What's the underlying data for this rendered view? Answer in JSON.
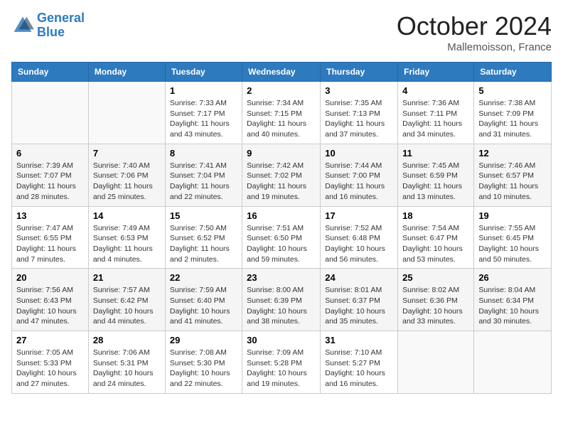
{
  "header": {
    "logo_line1": "General",
    "logo_line2": "Blue",
    "month_title": "October 2024",
    "location": "Mallemoisson, France"
  },
  "weekdays": [
    "Sunday",
    "Monday",
    "Tuesday",
    "Wednesday",
    "Thursday",
    "Friday",
    "Saturday"
  ],
  "weeks": [
    [
      {
        "day": "",
        "sunrise": "",
        "sunset": "",
        "daylight": ""
      },
      {
        "day": "",
        "sunrise": "",
        "sunset": "",
        "daylight": ""
      },
      {
        "day": "1",
        "sunrise": "Sunrise: 7:33 AM",
        "sunset": "Sunset: 7:17 PM",
        "daylight": "Daylight: 11 hours and 43 minutes."
      },
      {
        "day": "2",
        "sunrise": "Sunrise: 7:34 AM",
        "sunset": "Sunset: 7:15 PM",
        "daylight": "Daylight: 11 hours and 40 minutes."
      },
      {
        "day": "3",
        "sunrise": "Sunrise: 7:35 AM",
        "sunset": "Sunset: 7:13 PM",
        "daylight": "Daylight: 11 hours and 37 minutes."
      },
      {
        "day": "4",
        "sunrise": "Sunrise: 7:36 AM",
        "sunset": "Sunset: 7:11 PM",
        "daylight": "Daylight: 11 hours and 34 minutes."
      },
      {
        "day": "5",
        "sunrise": "Sunrise: 7:38 AM",
        "sunset": "Sunset: 7:09 PM",
        "daylight": "Daylight: 11 hours and 31 minutes."
      }
    ],
    [
      {
        "day": "6",
        "sunrise": "Sunrise: 7:39 AM",
        "sunset": "Sunset: 7:07 PM",
        "daylight": "Daylight: 11 hours and 28 minutes."
      },
      {
        "day": "7",
        "sunrise": "Sunrise: 7:40 AM",
        "sunset": "Sunset: 7:06 PM",
        "daylight": "Daylight: 11 hours and 25 minutes."
      },
      {
        "day": "8",
        "sunrise": "Sunrise: 7:41 AM",
        "sunset": "Sunset: 7:04 PM",
        "daylight": "Daylight: 11 hours and 22 minutes."
      },
      {
        "day": "9",
        "sunrise": "Sunrise: 7:42 AM",
        "sunset": "Sunset: 7:02 PM",
        "daylight": "Daylight: 11 hours and 19 minutes."
      },
      {
        "day": "10",
        "sunrise": "Sunrise: 7:44 AM",
        "sunset": "Sunset: 7:00 PM",
        "daylight": "Daylight: 11 hours and 16 minutes."
      },
      {
        "day": "11",
        "sunrise": "Sunrise: 7:45 AM",
        "sunset": "Sunset: 6:59 PM",
        "daylight": "Daylight: 11 hours and 13 minutes."
      },
      {
        "day": "12",
        "sunrise": "Sunrise: 7:46 AM",
        "sunset": "Sunset: 6:57 PM",
        "daylight": "Daylight: 11 hours and 10 minutes."
      }
    ],
    [
      {
        "day": "13",
        "sunrise": "Sunrise: 7:47 AM",
        "sunset": "Sunset: 6:55 PM",
        "daylight": "Daylight: 11 hours and 7 minutes."
      },
      {
        "day": "14",
        "sunrise": "Sunrise: 7:49 AM",
        "sunset": "Sunset: 6:53 PM",
        "daylight": "Daylight: 11 hours and 4 minutes."
      },
      {
        "day": "15",
        "sunrise": "Sunrise: 7:50 AM",
        "sunset": "Sunset: 6:52 PM",
        "daylight": "Daylight: 11 hours and 2 minutes."
      },
      {
        "day": "16",
        "sunrise": "Sunrise: 7:51 AM",
        "sunset": "Sunset: 6:50 PM",
        "daylight": "Daylight: 10 hours and 59 minutes."
      },
      {
        "day": "17",
        "sunrise": "Sunrise: 7:52 AM",
        "sunset": "Sunset: 6:48 PM",
        "daylight": "Daylight: 10 hours and 56 minutes."
      },
      {
        "day": "18",
        "sunrise": "Sunrise: 7:54 AM",
        "sunset": "Sunset: 6:47 PM",
        "daylight": "Daylight: 10 hours and 53 minutes."
      },
      {
        "day": "19",
        "sunrise": "Sunrise: 7:55 AM",
        "sunset": "Sunset: 6:45 PM",
        "daylight": "Daylight: 10 hours and 50 minutes."
      }
    ],
    [
      {
        "day": "20",
        "sunrise": "Sunrise: 7:56 AM",
        "sunset": "Sunset: 6:43 PM",
        "daylight": "Daylight: 10 hours and 47 minutes."
      },
      {
        "day": "21",
        "sunrise": "Sunrise: 7:57 AM",
        "sunset": "Sunset: 6:42 PM",
        "daylight": "Daylight: 10 hours and 44 minutes."
      },
      {
        "day": "22",
        "sunrise": "Sunrise: 7:59 AM",
        "sunset": "Sunset: 6:40 PM",
        "daylight": "Daylight: 10 hours and 41 minutes."
      },
      {
        "day": "23",
        "sunrise": "Sunrise: 8:00 AM",
        "sunset": "Sunset: 6:39 PM",
        "daylight": "Daylight: 10 hours and 38 minutes."
      },
      {
        "day": "24",
        "sunrise": "Sunrise: 8:01 AM",
        "sunset": "Sunset: 6:37 PM",
        "daylight": "Daylight: 10 hours and 35 minutes."
      },
      {
        "day": "25",
        "sunrise": "Sunrise: 8:02 AM",
        "sunset": "Sunset: 6:36 PM",
        "daylight": "Daylight: 10 hours and 33 minutes."
      },
      {
        "day": "26",
        "sunrise": "Sunrise: 8:04 AM",
        "sunset": "Sunset: 6:34 PM",
        "daylight": "Daylight: 10 hours and 30 minutes."
      }
    ],
    [
      {
        "day": "27",
        "sunrise": "Sunrise: 7:05 AM",
        "sunset": "Sunset: 5:33 PM",
        "daylight": "Daylight: 10 hours and 27 minutes."
      },
      {
        "day": "28",
        "sunrise": "Sunrise: 7:06 AM",
        "sunset": "Sunset: 5:31 PM",
        "daylight": "Daylight: 10 hours and 24 minutes."
      },
      {
        "day": "29",
        "sunrise": "Sunrise: 7:08 AM",
        "sunset": "Sunset: 5:30 PM",
        "daylight": "Daylight: 10 hours and 22 minutes."
      },
      {
        "day": "30",
        "sunrise": "Sunrise: 7:09 AM",
        "sunset": "Sunset: 5:28 PM",
        "daylight": "Daylight: 10 hours and 19 minutes."
      },
      {
        "day": "31",
        "sunrise": "Sunrise: 7:10 AM",
        "sunset": "Sunset: 5:27 PM",
        "daylight": "Daylight: 10 hours and 16 minutes."
      },
      {
        "day": "",
        "sunrise": "",
        "sunset": "",
        "daylight": ""
      },
      {
        "day": "",
        "sunrise": "",
        "sunset": "",
        "daylight": ""
      }
    ]
  ]
}
